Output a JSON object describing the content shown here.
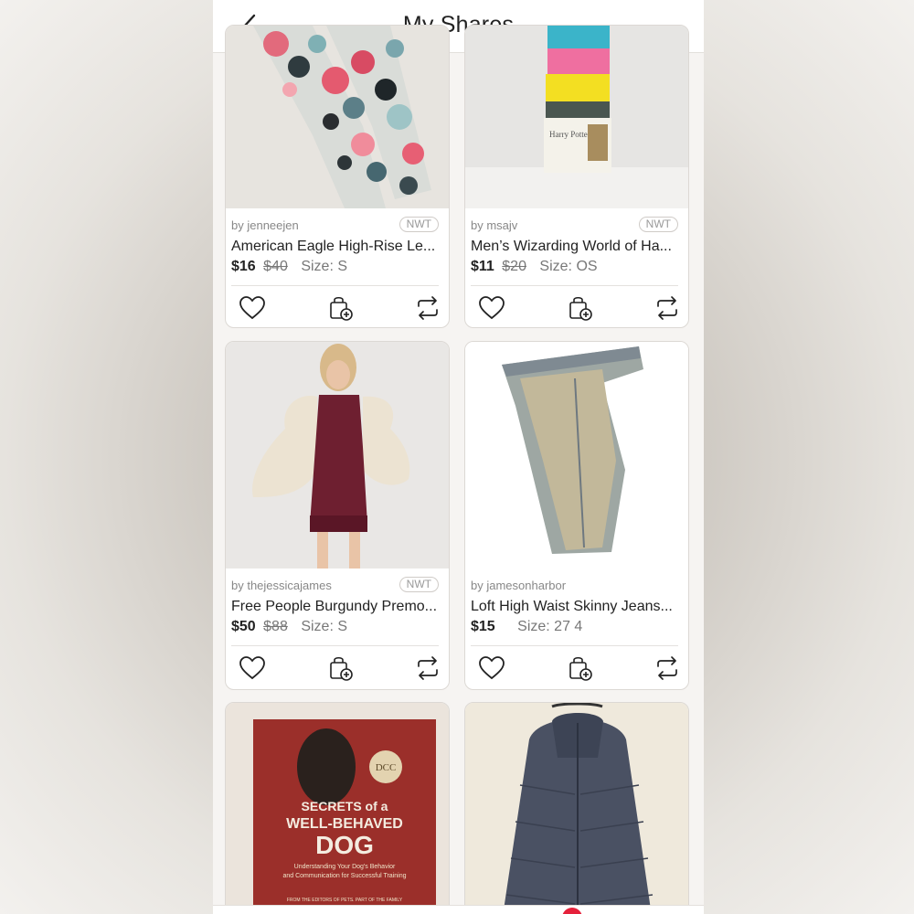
{
  "header": {
    "title": "My Shares",
    "back_icon": "chevron-left-icon"
  },
  "listings": [
    {
      "seller": "by jenneejen",
      "badge": "NWT",
      "name": "American Eagle High-Rise Le...",
      "price": "$16",
      "original_price": "$40",
      "size": "Size: S",
      "image": "floral-leggings"
    },
    {
      "seller": "by msajv",
      "badge": "NWT",
      "name": "Men’s Wizarding World of Ha...",
      "price": "$11",
      "original_price": "$20",
      "size": "Size: OS",
      "image": "harry-potter-socks-pack"
    },
    {
      "seller": "by thejessicajames",
      "badge": "NWT",
      "name": "Free People Burgundy Premo...",
      "price": "$50",
      "original_price": "$88",
      "size": "Size: S",
      "image": "burgundy-lace-dress"
    },
    {
      "seller": "by jamesonharbor",
      "badge": "",
      "name": "Loft High Waist Skinny Jeans...",
      "price": "$15",
      "original_price": "",
      "size": "Size: 27 4",
      "image": "skinny-jeans"
    },
    {
      "seller": "",
      "badge": "",
      "name": "",
      "price": "",
      "original_price": "",
      "size": "",
      "image": "dog-book"
    },
    {
      "seller": "",
      "badge": "",
      "name": "",
      "price": "",
      "original_price": "",
      "size": "",
      "image": "puffer-jacket"
    }
  ],
  "book_cover": {
    "badge": "DCC",
    "title_line1": "SECRETS of a",
    "title_line2": "WELL-BEHAVED",
    "title_line3": "DOG",
    "subtitle1": "Understanding Your Dog's Behavior",
    "subtitle2": "and Communication for Successful Training",
    "imprint": "FROM THE EDITORS OF PETS. PART OF THE FAMILY"
  },
  "sock_label": "Harry Potter",
  "colors": {
    "accent": "#e5213b",
    "card_border": "#dcd8d4",
    "text": "#222222",
    "muted": "#888888"
  }
}
